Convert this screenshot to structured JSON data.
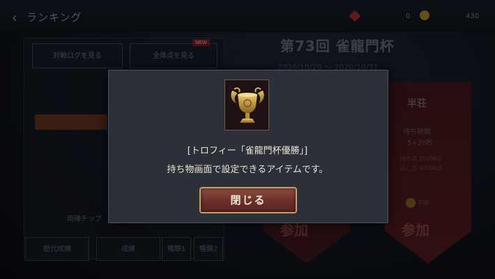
{
  "header": {
    "back_icon": "chevron-left-icon",
    "title": "ランキング",
    "currency1_value": "0",
    "currency2_value": "430"
  },
  "left_panel": {
    "tab1": "対戦ログを見る",
    "tab2": "全体点を見る",
    "tab2_badge": "NEW",
    "history_label": "両陣チップ",
    "buttons": [
      "歴代成績",
      "成績",
      "種類1",
      "種類2"
    ]
  },
  "event": {
    "title": "第73回 雀龍門杯",
    "dates": "2020/10/29 ～ 2020/10/31",
    "rank_label": "半荘",
    "rank_info1": "持ち時間",
    "rank_info2": "5+20秒",
    "rank_info3": "持ち点 25000点",
    "rank_info4": "返し点 30000点",
    "join_cost": "100",
    "join_label_left": "参加",
    "join_label_right": "参加"
  },
  "dialog": {
    "item_icon": "golden-dragon-trophy-icon",
    "item_name": "[トロフィー「雀龍門杯優勝」]",
    "item_description": "持ち物画面で設定できるアイテムです。",
    "close_label": "閉じる"
  },
  "colors": {
    "dialog_bg": "#2b3039",
    "button_bg": "#6b2f28",
    "button_border": "#c99a6e",
    "text": "#ece4d4"
  }
}
